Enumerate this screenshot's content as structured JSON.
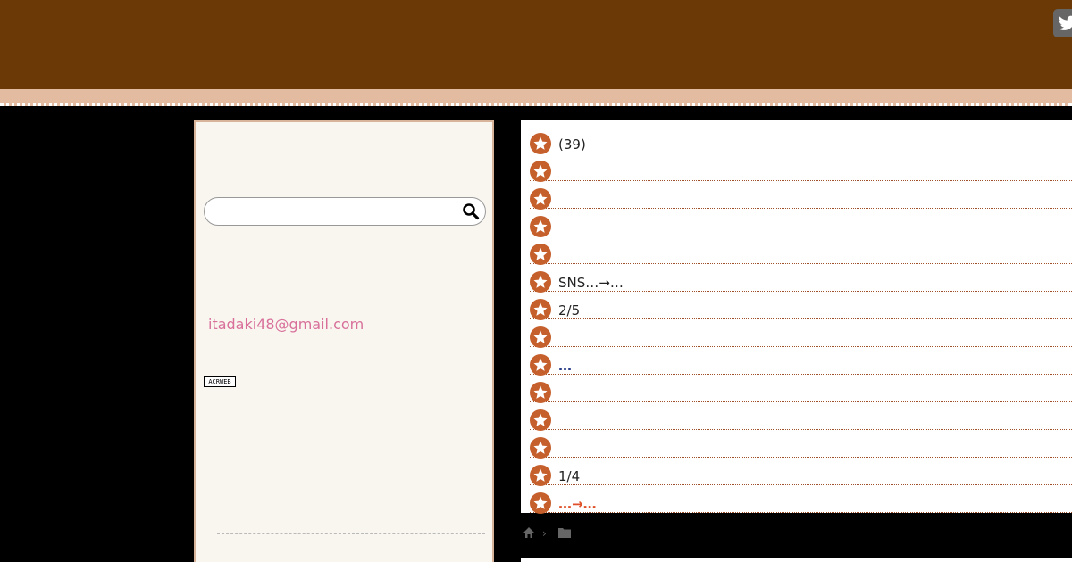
{
  "header": {
    "twitter_icon": "twitter-icon"
  },
  "sidebar": {
    "search": {
      "placeholder": "",
      "value": "",
      "icon": "search-icon"
    },
    "email": "itadaki48@gmail.com",
    "badge": "ACRWEB"
  },
  "list": {
    "icon": "star-icon",
    "items": [
      {
        "text": "(39)",
        "style": "normal"
      },
      {
        "text": "",
        "style": "normal"
      },
      {
        "text": "",
        "style": "normal"
      },
      {
        "text": "",
        "style": "normal"
      },
      {
        "text": "",
        "style": "normal"
      },
      {
        "text": "SNS…→…",
        "style": "normal"
      },
      {
        "text": "2/5",
        "style": "normal"
      },
      {
        "text": "",
        "style": "normal"
      },
      {
        "text": "…",
        "style": "blue"
      },
      {
        "text": "",
        "style": "normal"
      },
      {
        "text": "",
        "style": "normal"
      },
      {
        "text": "",
        "style": "normal"
      },
      {
        "text": "1/4",
        "style": "normal"
      },
      {
        "text": "…→…",
        "style": "red"
      }
    ]
  },
  "breadcrumb": {
    "home_icon": "home-icon",
    "separator": "›",
    "folder_icon": "folder-icon"
  },
  "colors": {
    "header": "#6b3906",
    "band": "#e3bba0",
    "accent": "#c55f2b",
    "email": "#d8709a"
  }
}
